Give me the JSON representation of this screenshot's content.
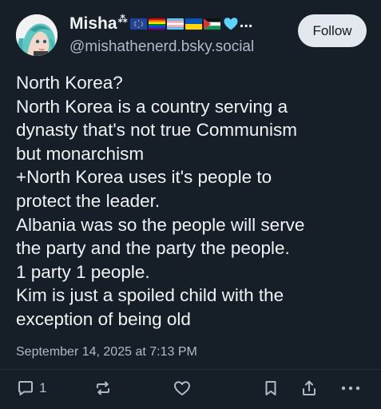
{
  "author": {
    "display_name": "Misha",
    "name_decoration": "⁂",
    "handle": "@mishathenerd.bsky.social",
    "truncation": "...",
    "flags": [
      "eu-flag",
      "rainbow-pride-flag",
      "transgender-flag",
      "ukraine-flag",
      "palestine-flag"
    ],
    "heart": "light-blue-heart"
  },
  "follow_label": "Follow",
  "post": {
    "text_lines": [
      "North Korea?",
      "North Korea is a country serving a",
      "dynasty that's not true Communism",
      "but monarchism",
      "+North Korea uses it's people to",
      "protect the leader.",
      "Albania was so the people will serve",
      "the party and the party the people.",
      "1 party 1 people.",
      "Kim is just a spoiled child with the",
      "exception of being old"
    ],
    "timestamp": "September 14, 2025 at 7:13 PM"
  },
  "actions": {
    "reply_count": "1",
    "icons": [
      "reply-icon",
      "repost-icon",
      "like-icon",
      "bookmark-icon",
      "share-icon",
      "more-icon"
    ]
  },
  "colors": {
    "background": "#161e27",
    "text": "#f1f3f5",
    "muted": "#aebbc9",
    "follow_bg": "#e3e8ee"
  }
}
